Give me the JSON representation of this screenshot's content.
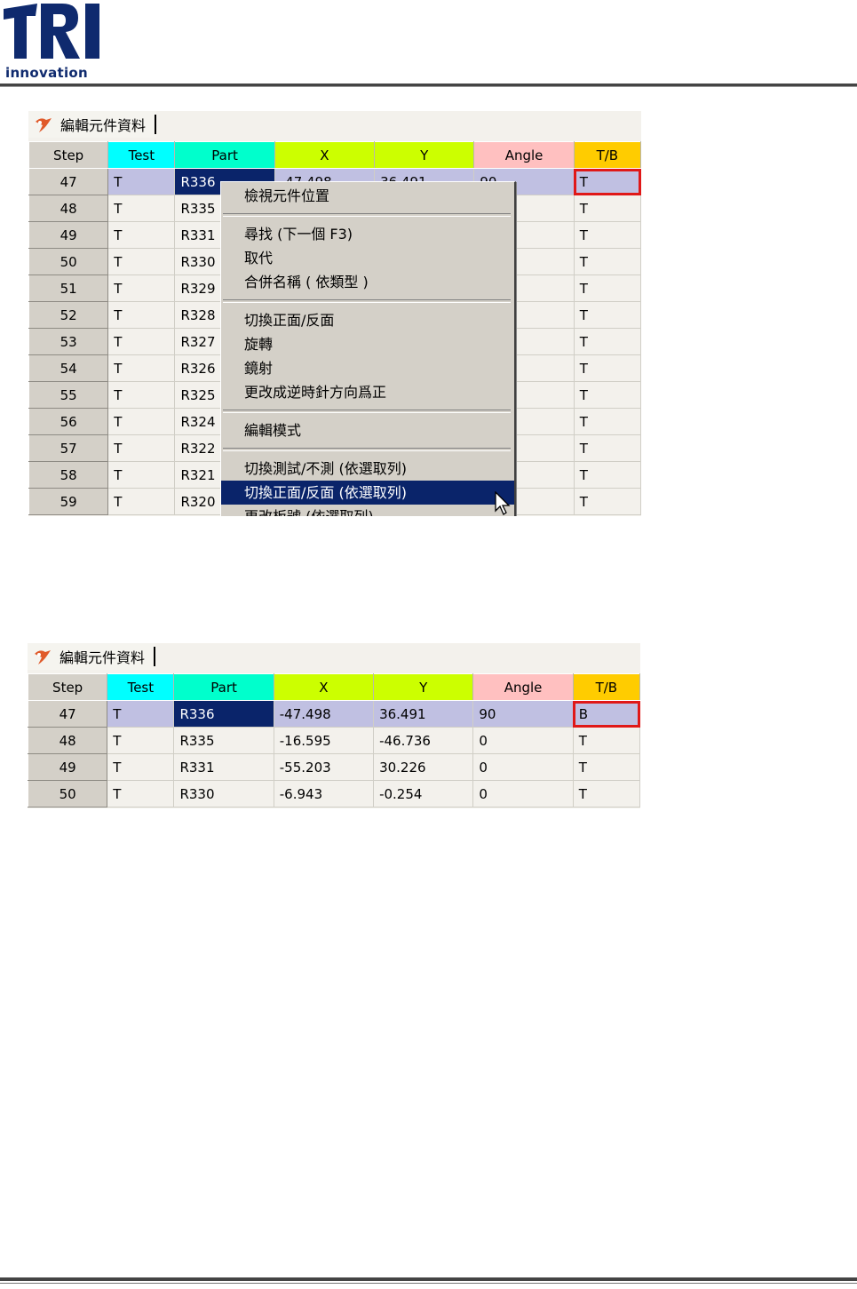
{
  "logo": {
    "mark": "TRI",
    "sub": "innovation"
  },
  "panel_title": "編輯元件資料",
  "columns": [
    "Step",
    "Test",
    "Part",
    "X",
    "Y",
    "Angle",
    "T/B"
  ],
  "header_colors": [
    "#d4d0c8",
    "#00ffff",
    "#00ffcc",
    "#ccff00",
    "#ccff00",
    "#ffc0c0",
    "#ffcc00"
  ],
  "accent": {
    "highlight_box": "#e01818",
    "selection": "#0a246a",
    "row_selected": "#c0c0e2"
  },
  "grid1": {
    "rows": [
      [
        "47",
        "T",
        "R336",
        "-47.498",
        "36.491",
        "90",
        "T"
      ],
      [
        "48",
        "T",
        "R335",
        "",
        "",
        "",
        "T"
      ],
      [
        "49",
        "T",
        "R331",
        "",
        "",
        "",
        "T"
      ],
      [
        "50",
        "T",
        "R330",
        "",
        "",
        "",
        "T"
      ],
      [
        "51",
        "T",
        "R329",
        "",
        "",
        "",
        "T"
      ],
      [
        "52",
        "T",
        "R328",
        "",
        "",
        "",
        "T"
      ],
      [
        "53",
        "T",
        "R327",
        "",
        "",
        "",
        "T"
      ],
      [
        "54",
        "T",
        "R326",
        "",
        "",
        "",
        "T"
      ],
      [
        "55",
        "T",
        "R325",
        "",
        "",
        "",
        "T"
      ],
      [
        "56",
        "T",
        "R324",
        "",
        "",
        "",
        "T"
      ],
      [
        "57",
        "T",
        "R322",
        "",
        "",
        "",
        "T"
      ],
      [
        "58",
        "T",
        "R321",
        "",
        "",
        "",
        "T"
      ],
      [
        "59",
        "T",
        "R320",
        "",
        "",
        "",
        "T"
      ]
    ]
  },
  "context_menu": {
    "groups": [
      [
        "檢視元件位置"
      ],
      [
        "尋找 (下一個 F3)",
        "取代",
        "合併名稱 ( 依類型 )"
      ],
      [
        "切換正面/反面",
        "旋轉",
        "鏡射",
        "更改成逆時針方向爲正"
      ],
      [
        "編輯模式"
      ],
      [
        "切換測試/不測 (依選取列)",
        "切換正面/反面 (依選取列)",
        "更改板號 (依選取列)"
      ]
    ],
    "highlighted": "切換正面/反面 (依選取列)"
  },
  "grid2": {
    "rows": [
      [
        "47",
        "T",
        "R336",
        "-47.498",
        "36.491",
        "90",
        "B"
      ],
      [
        "48",
        "T",
        "R335",
        "-16.595",
        "-46.736",
        "0",
        "T"
      ],
      [
        "49",
        "T",
        "R331",
        "-55.203",
        "30.226",
        "0",
        "T"
      ],
      [
        "50",
        "T",
        "R330",
        "-6.943",
        "-0.254",
        "0",
        "T"
      ]
    ]
  }
}
